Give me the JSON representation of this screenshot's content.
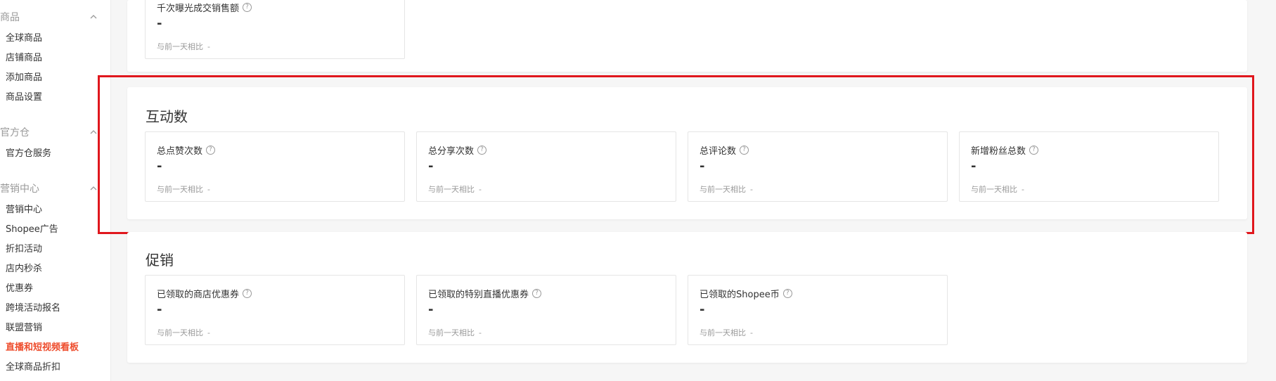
{
  "sidebar": {
    "groups": [
      {
        "title": "商品",
        "items": [
          "全球商品",
          "店铺商品",
          "添加商品",
          "商品设置"
        ]
      },
      {
        "title": "官方仓",
        "items": [
          "官方仓服务"
        ]
      },
      {
        "title": "营销中心",
        "items": [
          "营销中心",
          "Shopee广告",
          "折扣活动",
          "店内秒杀",
          "优惠券",
          "跨境活动报名",
          "联盟营销",
          "直播和短视频看板",
          "全球商品折扣"
        ]
      }
    ],
    "active_item": "直播和短视频看板"
  },
  "top_card": {
    "label": "千次曝光成交销售额",
    "value": "-",
    "compare_label": "与前一天相比",
    "compare_value": "-"
  },
  "interaction": {
    "title": "互动数",
    "metrics": [
      {
        "label": "总点赞次数",
        "value": "-",
        "compare_label": "与前一天相比",
        "compare_value": "-"
      },
      {
        "label": "总分享次数",
        "value": "-",
        "compare_label": "与前一天相比",
        "compare_value": "-"
      },
      {
        "label": "总评论数",
        "value": "-",
        "compare_label": "与前一天相比",
        "compare_value": "-"
      },
      {
        "label": "新增粉丝总数",
        "value": "-",
        "compare_label": "与前一天相比",
        "compare_value": "-"
      }
    ]
  },
  "promotion": {
    "title": "促销",
    "metrics": [
      {
        "label": "已领取的商店优惠券",
        "value": "-",
        "compare_label": "与前一天相比",
        "compare_value": "-"
      },
      {
        "label": "已领取的特别直播优惠券",
        "value": "-",
        "compare_label": "与前一天相比",
        "compare_value": "-"
      },
      {
        "label": "已领取的Shopee币",
        "value": "-",
        "compare_label": "与前一天相比",
        "compare_value": "-"
      }
    ]
  },
  "help_glyph": "?",
  "colors": {
    "accent": "#ee4d2d",
    "highlight_border": "#e0171d"
  }
}
